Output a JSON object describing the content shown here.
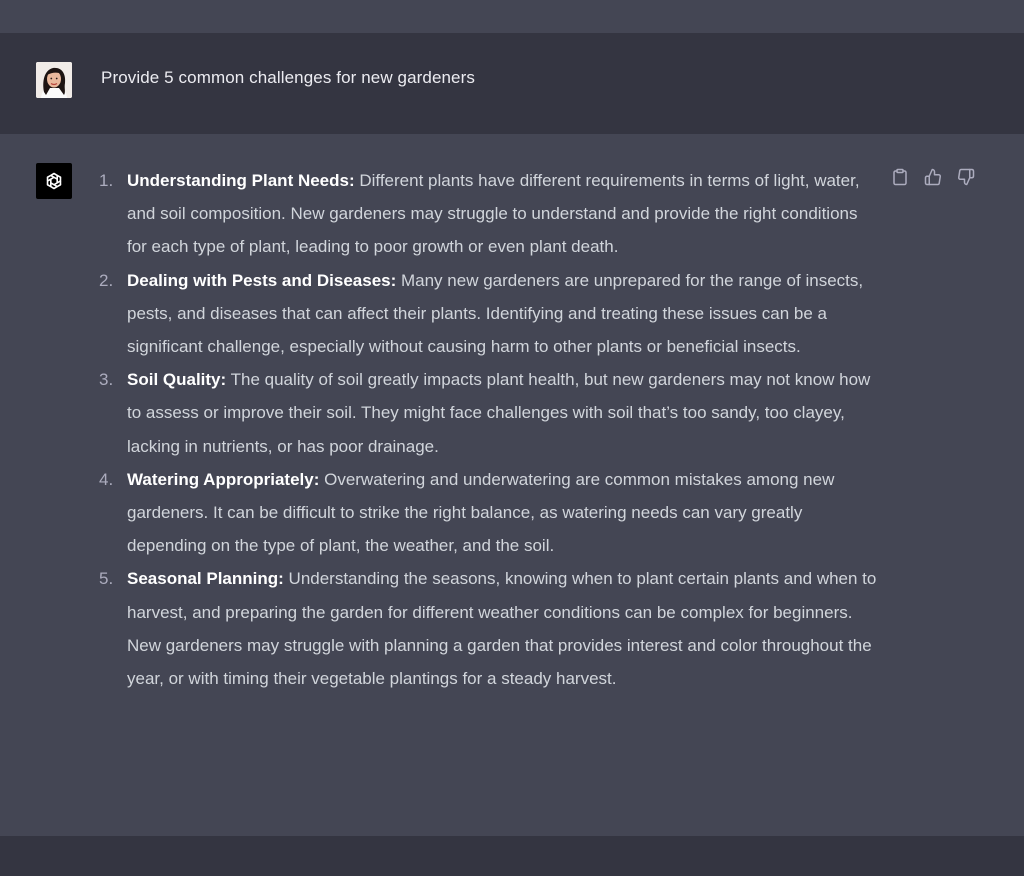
{
  "conversation": {
    "user_message": "Provide 5 common challenges for new gardeners",
    "assistant": {
      "items": [
        {
          "number": "1.",
          "title": "Understanding Plant Needs:",
          "text": " Different plants have different requirements in terms of light, water, and soil composition. New gardeners may struggle to understand and provide the right conditions for each type of plant, leading to poor growth or even plant death."
        },
        {
          "number": "2.",
          "title": "Dealing with Pests and Diseases:",
          "text": " Many new gardeners are unprepared for the range of insects, pests, and diseases that can affect their plants. Identifying and treating these issues can be a significant challenge, especially without causing harm to other plants or beneficial insects."
        },
        {
          "number": "3.",
          "title": "Soil Quality:",
          "text": " The quality of soil greatly impacts plant health, but new gardeners may not know how to assess or improve their soil. They might face challenges with soil that’s too sandy, too clayey, lacking in nutrients, or has poor drainage."
        },
        {
          "number": "4.",
          "title": "Watering Appropriately:",
          "text": " Overwatering and underwatering are common mistakes among new gardeners. It can be difficult to strike the right balance, as watering needs can vary greatly depending on the type of plant, the weather, and the soil."
        },
        {
          "number": "5.",
          "title": "Seasonal Planning:",
          "text": " Understanding the seasons, knowing when to plant certain plants and when to harvest, and preparing the garden for different weather conditions can be complex for beginners. New gardeners may struggle with planning a garden that provides interest and color throughout the year, or with timing their vegetable plantings for a steady harvest."
        }
      ]
    }
  },
  "actions": {
    "icons": [
      "clipboard-icon",
      "thumbs-up-icon",
      "thumbs-down-icon"
    ]
  },
  "colors": {
    "user_bg": "#343541",
    "assistant_bg": "#444654",
    "text": "#d1d5db",
    "bold_text": "#ffffff",
    "bot_avatar_bg": "#000000"
  }
}
